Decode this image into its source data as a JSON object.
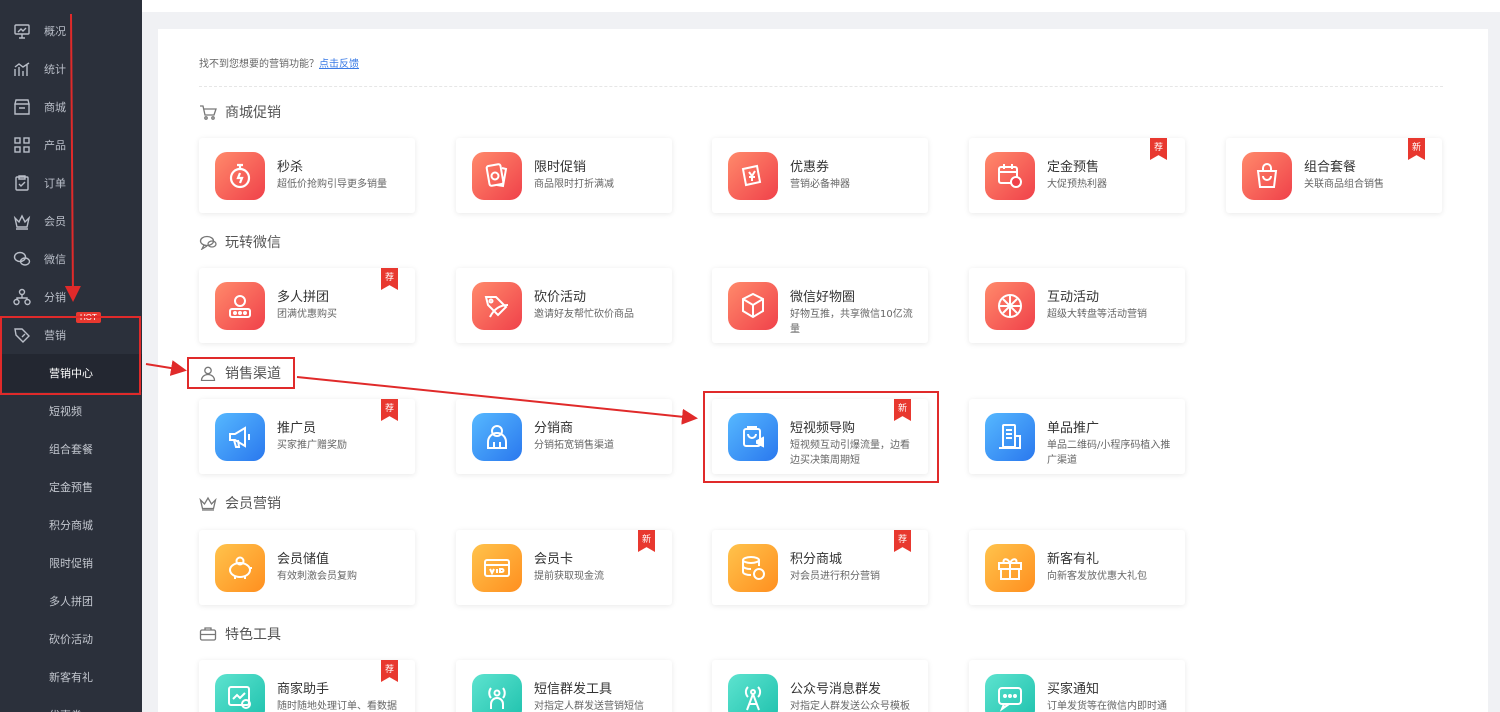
{
  "sidebar": {
    "items": [
      {
        "label": "概况",
        "icon": "dashboard-icon"
      },
      {
        "label": "统计",
        "icon": "stats-chart-icon"
      },
      {
        "label": "商城",
        "icon": "store-icon"
      },
      {
        "label": "产品",
        "icon": "grid-icon"
      },
      {
        "label": "订单",
        "icon": "order-clipboard-icon"
      },
      {
        "label": "会员",
        "icon": "crown-icon"
      },
      {
        "label": "微信",
        "icon": "wechat-icon"
      },
      {
        "label": "分销",
        "icon": "distribution-icon"
      },
      {
        "label": "营销",
        "icon": "marketing-tag-icon"
      }
    ],
    "hot_badge": "HOT",
    "sub_items": [
      "营销中心",
      "短视频",
      "组合套餐",
      "定金预售",
      "积分商城",
      "限时促销",
      "多人拼团",
      "砍价活动",
      "新客有礼",
      "优惠券"
    ]
  },
  "notice": {
    "text": "找不到您想要的营销功能？",
    "link": "点击反馈"
  },
  "sections": [
    {
      "title": "商城促销",
      "icon": "cart-icon",
      "cards": [
        {
          "title": "秒杀",
          "desc": "超低价抢购引导更多销量",
          "color": "red",
          "icon": "stopwatch-icon",
          "badge": ""
        },
        {
          "title": "限时促销",
          "desc": "商品限时打折满减",
          "color": "red",
          "icon": "price-tag-icon",
          "badge": ""
        },
        {
          "title": "优惠券",
          "desc": "营销必备神器",
          "color": "red",
          "icon": "coupon-icon",
          "badge": ""
        },
        {
          "title": "定金预售",
          "desc": "大促预热利器",
          "color": "red",
          "icon": "calendar-coin-icon",
          "badge": "荐"
        },
        {
          "title": "组合套餐",
          "desc": "关联商品组合销售",
          "color": "red",
          "icon": "shopping-bag-icon",
          "badge": "新"
        }
      ]
    },
    {
      "title": "玩转微信",
      "icon": "chat-bubble-icon",
      "cards": [
        {
          "title": "多人拼团",
          "desc": "团满优惠购买",
          "color": "red",
          "icon": "group-buy-icon",
          "badge": "荐"
        },
        {
          "title": "砍价活动",
          "desc": "邀请好友帮忙砍价商品",
          "color": "red",
          "icon": "bargain-icon",
          "badge": ""
        },
        {
          "title": "微信好物圈",
          "desc": "好物互推，共享微信10亿流量",
          "color": "red",
          "icon": "box-3d-icon",
          "badge": ""
        },
        {
          "title": "互动活动",
          "desc": "超级大转盘等活动营销",
          "color": "red",
          "icon": "spin-wheel-icon",
          "badge": ""
        }
      ]
    },
    {
      "title": "销售渠道",
      "icon": "person-icon",
      "cards": [
        {
          "title": "推广员",
          "desc": "买家推广赠奖励",
          "color": "blue",
          "icon": "megaphone-icon",
          "badge": "荐"
        },
        {
          "title": "分销商",
          "desc": "分销拓宽销售渠道",
          "color": "blue",
          "icon": "distributor-icon",
          "badge": ""
        },
        {
          "title": "短视频导购",
          "desc": "短视频互动引爆流量，边看边买决策周期短",
          "color": "blue",
          "icon": "video-shopping-icon",
          "badge": "新"
        },
        {
          "title": "单品推广",
          "desc": "单品二维码/小程序码植入推广渠道",
          "color": "blue",
          "icon": "building-qr-icon",
          "badge": ""
        }
      ]
    },
    {
      "title": "会员营销",
      "icon": "crown-icon",
      "cards": [
        {
          "title": "会员储值",
          "desc": "有效刺激会员复购",
          "color": "orange",
          "icon": "piggy-bank-icon",
          "badge": ""
        },
        {
          "title": "会员卡",
          "desc": "提前获取现金流",
          "color": "orange",
          "icon": "vip-card-icon",
          "badge": "新"
        },
        {
          "title": "积分商城",
          "desc": "对会员进行积分营销",
          "color": "orange",
          "icon": "coin-stack-icon",
          "badge": "荐"
        },
        {
          "title": "新客有礼",
          "desc": "向新客发放优惠大礼包",
          "color": "orange",
          "icon": "gift-icon",
          "badge": ""
        }
      ]
    },
    {
      "title": "特色工具",
      "icon": "toolbox-icon",
      "cards": [
        {
          "title": "商家助手",
          "desc": "随时随地处理订单、看数据",
          "color": "teal",
          "icon": "assistant-chart-icon",
          "badge": "荐"
        },
        {
          "title": "短信群发工具",
          "desc": "对指定人群发送营销短信",
          "color": "teal",
          "icon": "sms-broadcast-icon",
          "badge": ""
        },
        {
          "title": "公众号消息群发",
          "desc": "对指定人群发送公众号模板消息",
          "color": "teal",
          "icon": "signal-tower-icon",
          "badge": ""
        },
        {
          "title": "买家通知",
          "desc": "订单发货等在微信内即时通知买家",
          "color": "teal",
          "icon": "chat-notify-icon",
          "badge": ""
        }
      ]
    }
  ],
  "colors": {
    "red": "#f0414a",
    "blue": "#2a78ee",
    "orange": "#ff8f1f",
    "teal": "#1ec1ad",
    "highlight": "#e02a2a",
    "sidebar": "#2b303b"
  }
}
